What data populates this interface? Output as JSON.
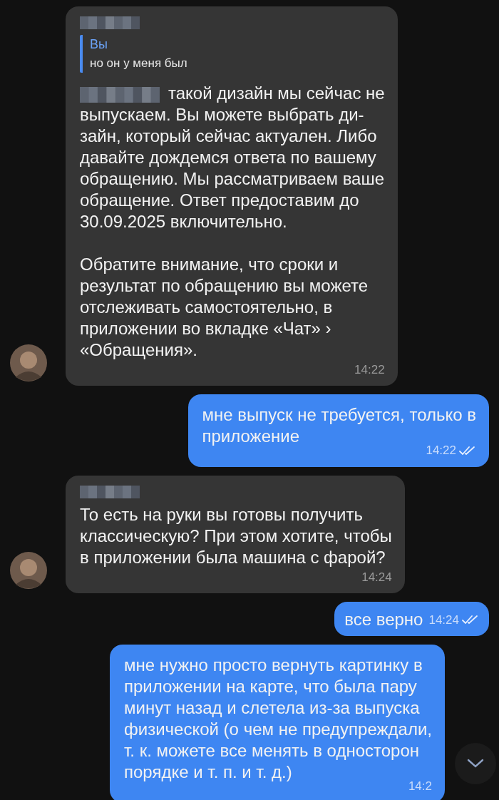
{
  "messages": [
    {
      "kind": "incoming",
      "sender_hidden": true,
      "avatar": true,
      "quote": {
        "author": "Вы",
        "text": "но он у меня был"
      },
      "mention_hidden": true,
      "text": "такой дизайн мы сейчас не\nвыпускаем. Вы можете выбрать ди-\nзайн, который сейчас актуален. Либо\nдавайте дождемся ответа по вашему\nобращению. Мы рассматриваем ваше\nобращение. Ответ предоставим до\n30.09.2025 включительно.\n\nОбратите внимание, что сроки и\nрезультат по обращению вы можете\nотслеживать самостоятельно, в\nприложении во вкладке «Чат» ›\n«Обращения».",
      "time": "14:22"
    },
    {
      "kind": "outgoing",
      "read": true,
      "text": "мне выпуск не требуется, только в\nприложение",
      "time": "14:22"
    },
    {
      "kind": "incoming",
      "sender_hidden": true,
      "avatar": true,
      "text": "То есть на руки вы готовы получить\nклассическую? При этом хотите, чтобы\nв приложении была машина с фарой?",
      "time": "14:24"
    },
    {
      "kind": "outgoing",
      "read": true,
      "inline_time": true,
      "text": "все верно",
      "time": "14:24"
    },
    {
      "kind": "outgoing",
      "text": "мне нужно просто вернуть картинку в\nприложении на карте, что была пару\nминут назад и слетела из-за выпуска\nфизической (о чем не предупреждали,\nт. к. можете все менять в односторон\nпорядке и т. п. и т. д.)",
      "time": "14:2"
    }
  ]
}
